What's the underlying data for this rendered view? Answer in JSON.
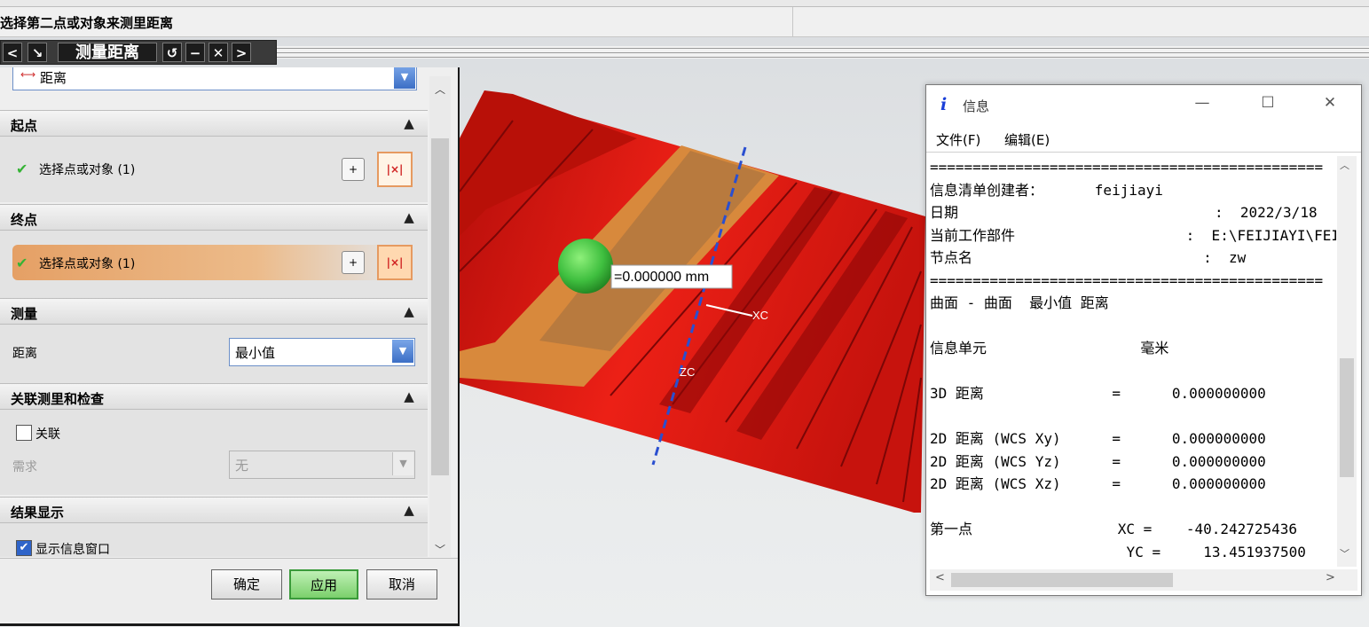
{
  "cue_line": "选择第二点或对象来测里距离",
  "dialog": {
    "title": "测量距离",
    "toolbar": {
      "back": "<",
      "select": "↘",
      "reset": "↺",
      "minimize": "−",
      "close": "✕",
      "forward": ">"
    },
    "type_value": "距离",
    "groups": {
      "start": {
        "header": "起点",
        "select_label": "选择点或对象 (1)"
      },
      "end": {
        "header": "终点",
        "select_label": "选择点或对象 (1)"
      },
      "measure": {
        "header": "测量",
        "distance_label": "距离",
        "distance_value": "最小值"
      },
      "assoc": {
        "header": "关联测里和检查",
        "assoc_label": "关联",
        "assoc_checked": false,
        "requirement_label": "需求",
        "requirement_value": "无"
      },
      "result": {
        "header": "结果显示",
        "show_info_label": "显示信息窗口",
        "show_info_checked": true
      }
    },
    "buttons": {
      "ok": "确定",
      "apply": "应用",
      "cancel": "取消"
    }
  },
  "viewport": {
    "measure_label": "=0.000000 mm",
    "axis_xc": "XC",
    "axis_zc": "ZC",
    "colors": {
      "part": "#e01a12",
      "highlight": "#d8893c",
      "marker": "#3fbf3f",
      "axis": "#2a4fd0"
    }
  },
  "info_window": {
    "title": "信息",
    "menu": [
      "文件(F)",
      "编辑(E)"
    ],
    "controls": {
      "minimize": "—",
      "maximize": "☐",
      "close": "✕"
    },
    "lines": [
      "==============================================",
      "信息清单创建者：      feijiayi",
      "日期                              :  2022/3/18",
      "当前工作部件                    :  E:\\FEIJIAYI\\FEI",
      "节点名                           :  zw",
      "==============================================",
      "曲面 - 曲面  最小值 距离",
      "",
      "信息单元                  毫米",
      "",
      "3D 距离               =      0.000000000",
      "",
      "2D 距离 (WCS Xy)      =      0.000000000",
      "2D 距离 (WCS Yz)      =      0.000000000",
      "2D 距离 (WCS Xz)      =      0.000000000",
      "",
      "第一点                 XC =    -40.242725436",
      "                       YC =     13.451937500"
    ]
  }
}
